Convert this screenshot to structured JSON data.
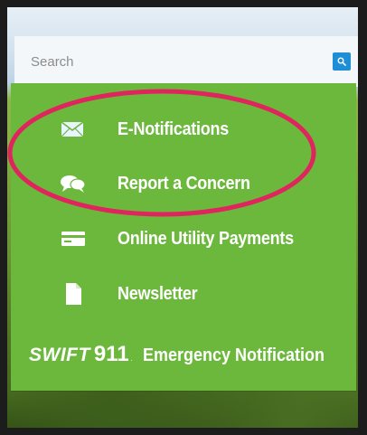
{
  "search": {
    "placeholder": "Search"
  },
  "menu": {
    "items": [
      {
        "label": "E-Notifications",
        "icon": "envelope-icon"
      },
      {
        "label": "Report a Concern",
        "icon": "speech-bubbles-icon"
      },
      {
        "label": "Online Utility Payments",
        "icon": "payment-card-icon"
      },
      {
        "label": "Newsletter",
        "icon": "document-icon"
      }
    ],
    "swift": {
      "logo_word": "SWIFT",
      "logo_number": "911",
      "label": "Emergency Notification"
    }
  },
  "colors": {
    "panel": "#6cb83d",
    "search_button": "#1e8fd6",
    "annotation": "#e0245e"
  }
}
